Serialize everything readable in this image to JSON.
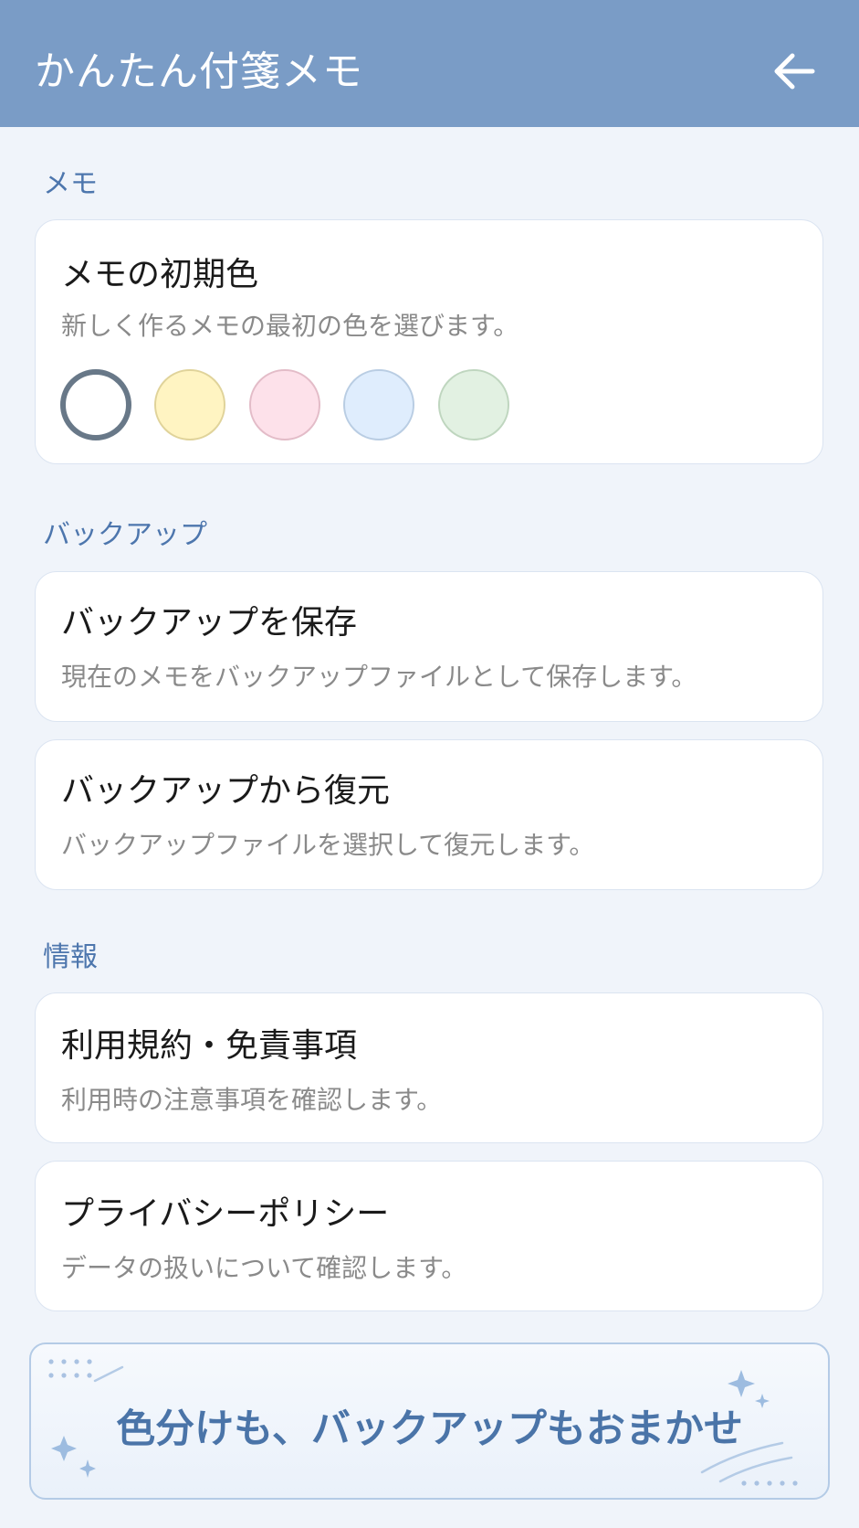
{
  "appbar": {
    "title": "かんたん付箋メモ"
  },
  "memo_section": {
    "label": "メモ",
    "default_color": {
      "title": "メモの初期色",
      "desc": "新しく作るメモの最初の色を選びます。",
      "swatches": [
        "white",
        "yellow",
        "pink",
        "blue",
        "green"
      ],
      "swatch_colors": [
        "#ffffff",
        "#fff4c2",
        "#fde1ea",
        "#dfedfd",
        "#e2f1e2"
      ],
      "selected": "white"
    }
  },
  "backup_section": {
    "label": "バックアップ",
    "save": {
      "title": "バックアップを保存",
      "desc": "現在のメモをバックアップファイルとして保存します。"
    },
    "restore": {
      "title": "バックアップから復元",
      "desc": "バックアップファイルを選択して復元します。"
    }
  },
  "info_section": {
    "label": "情報",
    "terms": {
      "title": "利用規約・免責事項",
      "desc": "利用時の注意事項を確認します。"
    },
    "privacy": {
      "title": "プライバシーポリシー",
      "desc": "データの扱いについて確認します。"
    }
  },
  "banner": {
    "text": "色分けも、バックアップもおまかせ"
  },
  "colors": {
    "appbar": "#7a9cc6",
    "accent": "#4d76ad",
    "background": "#f0f4fa"
  }
}
